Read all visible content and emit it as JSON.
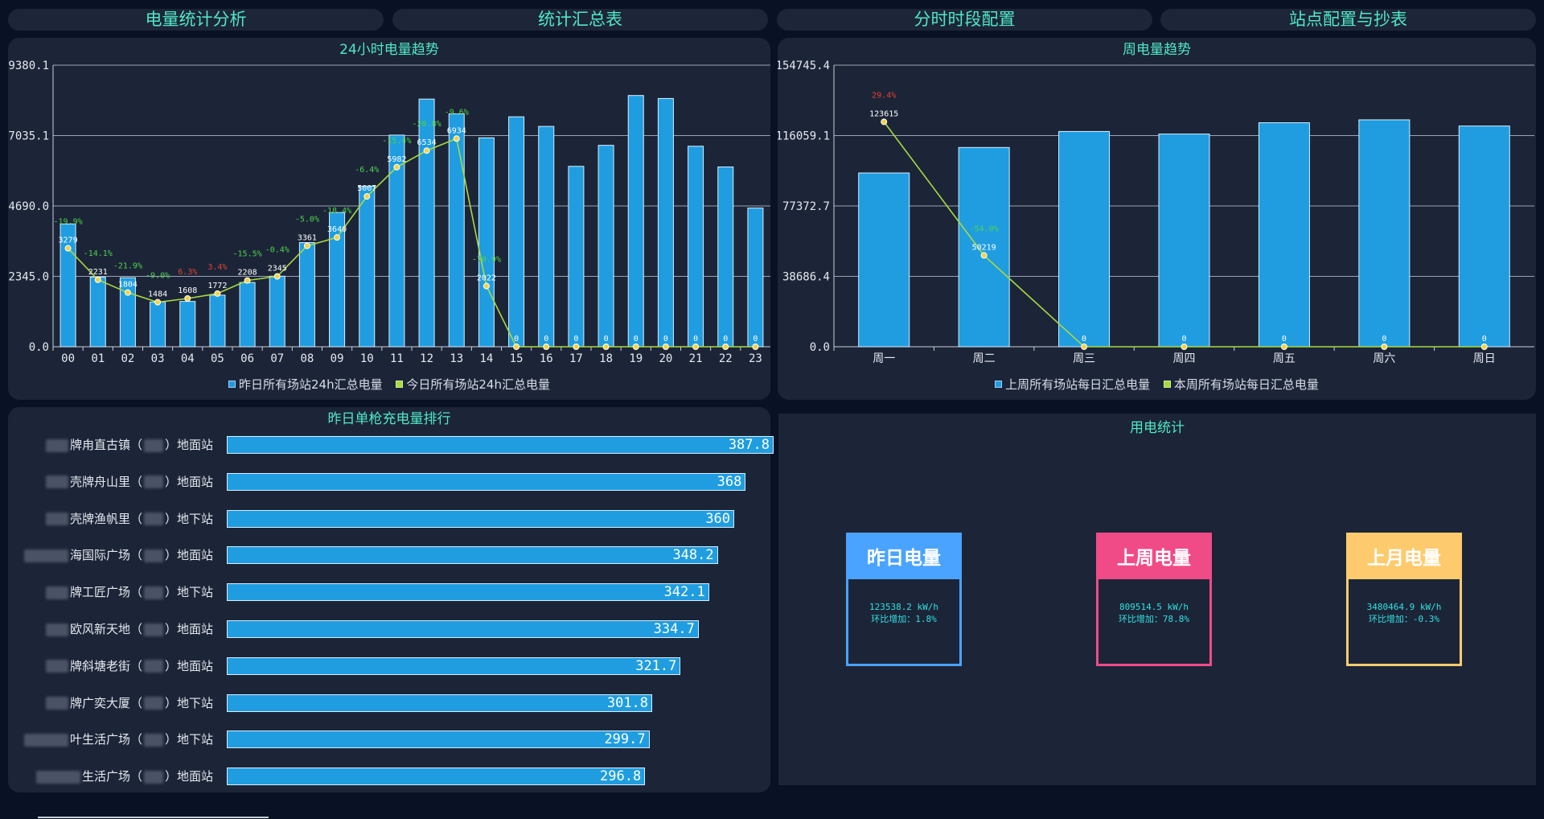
{
  "tabs": [
    "电量统计分析",
    "统计汇总表",
    "分时时段配置",
    "站点配置与抄表"
  ],
  "hourly": {
    "title": "24小时电量趋势",
    "ytick_labels": [
      "0.0",
      "2345.0",
      "4690.0",
      "7035.1",
      "9380.1"
    ],
    "legend": [
      "昨日所有场站24h汇总电量",
      "今日所有场站24h汇总电量"
    ]
  },
  "weekly": {
    "title": "周电量趋势",
    "ytick_labels": [
      "0.0",
      "38686.4",
      "77372.7",
      "116059.1",
      "154745.4"
    ],
    "legend": [
      "上周所有场站每日汇总电量",
      "本周所有场站每日汇总电量"
    ]
  },
  "ranking": {
    "title": "昨日单枪充电量排行",
    "items": [
      {
        "pre": "",
        "name": "牌甪直古镇",
        "suf": "）地面站",
        "value": "387.8",
        "ratio": 1.0
      },
      {
        "pre": "",
        "name": "壳牌舟山里",
        "suf": "）地面站",
        "value": "368",
        "ratio": 0.949
      },
      {
        "pre": "",
        "name": "壳牌渔帆里",
        "suf": "）地下站",
        "value": "360",
        "ratio": 0.928
      },
      {
        "pre": "",
        "name": "海国际广场",
        "suf": "）地面站",
        "value": "348.2",
        "ratio": 0.898
      },
      {
        "pre": "",
        "name": "牌工匠广场",
        "suf": "）地下站",
        "value": "342.1",
        "ratio": 0.882
      },
      {
        "pre": "",
        "name": "欧风新天地",
        "suf": "）地面站",
        "value": "334.7",
        "ratio": 0.863
      },
      {
        "pre": "",
        "name": "牌斜塘老街",
        "suf": "）地面站",
        "value": "321.7",
        "ratio": 0.83
      },
      {
        "pre": "",
        "name": "牌广奕大厦",
        "suf": "）地下站",
        "value": "301.8",
        "ratio": 0.778
      },
      {
        "pre": "",
        "name": "叶生活广场",
        "suf": "）地下站",
        "value": "299.7",
        "ratio": 0.773
      },
      {
        "pre": "",
        "name": "生活广场",
        "suf": "）地面站",
        "value": "296.8",
        "ratio": 0.765
      }
    ]
  },
  "usage": {
    "title": "用电统计",
    "cards": [
      {
        "title": "昨日电量",
        "line1": "123538.2 kW/h",
        "line2": "环比增加：1.8%",
        "color": "#4aa3ff"
      },
      {
        "title": "上周电量",
        "line1": "809514.5 kW/h",
        "line2": "环比增加：78.8%",
        "color": "#f14b87"
      },
      {
        "title": "上月电量",
        "line1": "3480464.9 kW/h",
        "line2": "环比增加：-0.3%",
        "color": "#fdcb6e"
      }
    ]
  },
  "colors": {
    "bar": "#1f9de0",
    "line": "#a8d93f",
    "point": "#f2d24b",
    "up": "#e0422f",
    "down": "#4fd34b",
    "accent": "#4ee8c5"
  },
  "chart_data": [
    {
      "type": "bar",
      "title": "24小时电量趋势",
      "categories": [
        "00",
        "01",
        "02",
        "03",
        "04",
        "05",
        "06",
        "07",
        "08",
        "09",
        "10",
        "11",
        "12",
        "13",
        "14",
        "15",
        "16",
        "17",
        "18",
        "19",
        "20",
        "21",
        "22",
        "23"
      ],
      "ylim": [
        0,
        9380.1
      ],
      "series": [
        {
          "name": "昨日所有场站24h汇总电量",
          "type": "bar",
          "values": [
            4090,
            2320,
            2300,
            1490,
            1510,
            1720,
            2140,
            2350,
            3470,
            4470,
            5350,
            7050,
            8250,
            7760,
            6960,
            7660,
            7340,
            6010,
            6710,
            8370,
            8270,
            6680,
            5990,
            4620
          ]
        },
        {
          "name": "今日所有场站24h汇总电量",
          "type": "line",
          "values": [
            3279,
            2231,
            1804,
            1484,
            1608,
            1772,
            2208,
            2345,
            3361,
            3640,
            5007,
            5982,
            6534,
            6934,
            2022,
            0,
            0,
            0,
            0,
            0,
            0,
            0,
            0,
            0
          ],
          "labels": [
            "3279",
            "2231",
            "1804",
            "1484",
            "1608",
            "1772",
            "2208",
            "2345",
            "3361",
            "3640",
            "5007",
            "5982",
            "6534",
            "6934",
            "2022",
            "0",
            "0",
            "0",
            "0",
            "0",
            "0",
            "0",
            "0",
            "0"
          ],
          "pct": [
            "-19.9%",
            "-14.1%",
            "-21.9%",
            "-9.0%",
            "6.3%",
            "3.4%",
            "-15.5%",
            "-0.4%",
            "-5.0%",
            "-18.4%",
            "-6.4%",
            "-15.4%",
            "-20.8%",
            "-9.6%",
            "-70.9%",
            "",
            "",
            "",
            "",
            "",
            "",
            "",
            "",
            ""
          ]
        }
      ],
      "legend_position": "bottom",
      "grid": true
    },
    {
      "type": "bar",
      "title": "周电量趋势",
      "categories": [
        "周一",
        "周二",
        "周三",
        "周四",
        "周五",
        "周六",
        "周日"
      ],
      "ylim": [
        0,
        154745.4
      ],
      "series": [
        {
          "name": "上周所有场站每日汇总电量",
          "type": "bar",
          "values": [
            95500,
            109500,
            118300,
            116900,
            123100,
            124700,
            121300
          ]
        },
        {
          "name": "本周所有场站每日汇总电量",
          "type": "line",
          "values": [
            123615,
            50219,
            0,
            0,
            0,
            0,
            0
          ],
          "labels": [
            "123615",
            "50219",
            "0",
            "0",
            "0",
            "0",
            "0"
          ],
          "pct": [
            "29.4%",
            "-54.0%",
            "",
            "",
            "",
            "",
            ""
          ]
        }
      ],
      "legend_position": "bottom",
      "grid": true
    }
  ]
}
